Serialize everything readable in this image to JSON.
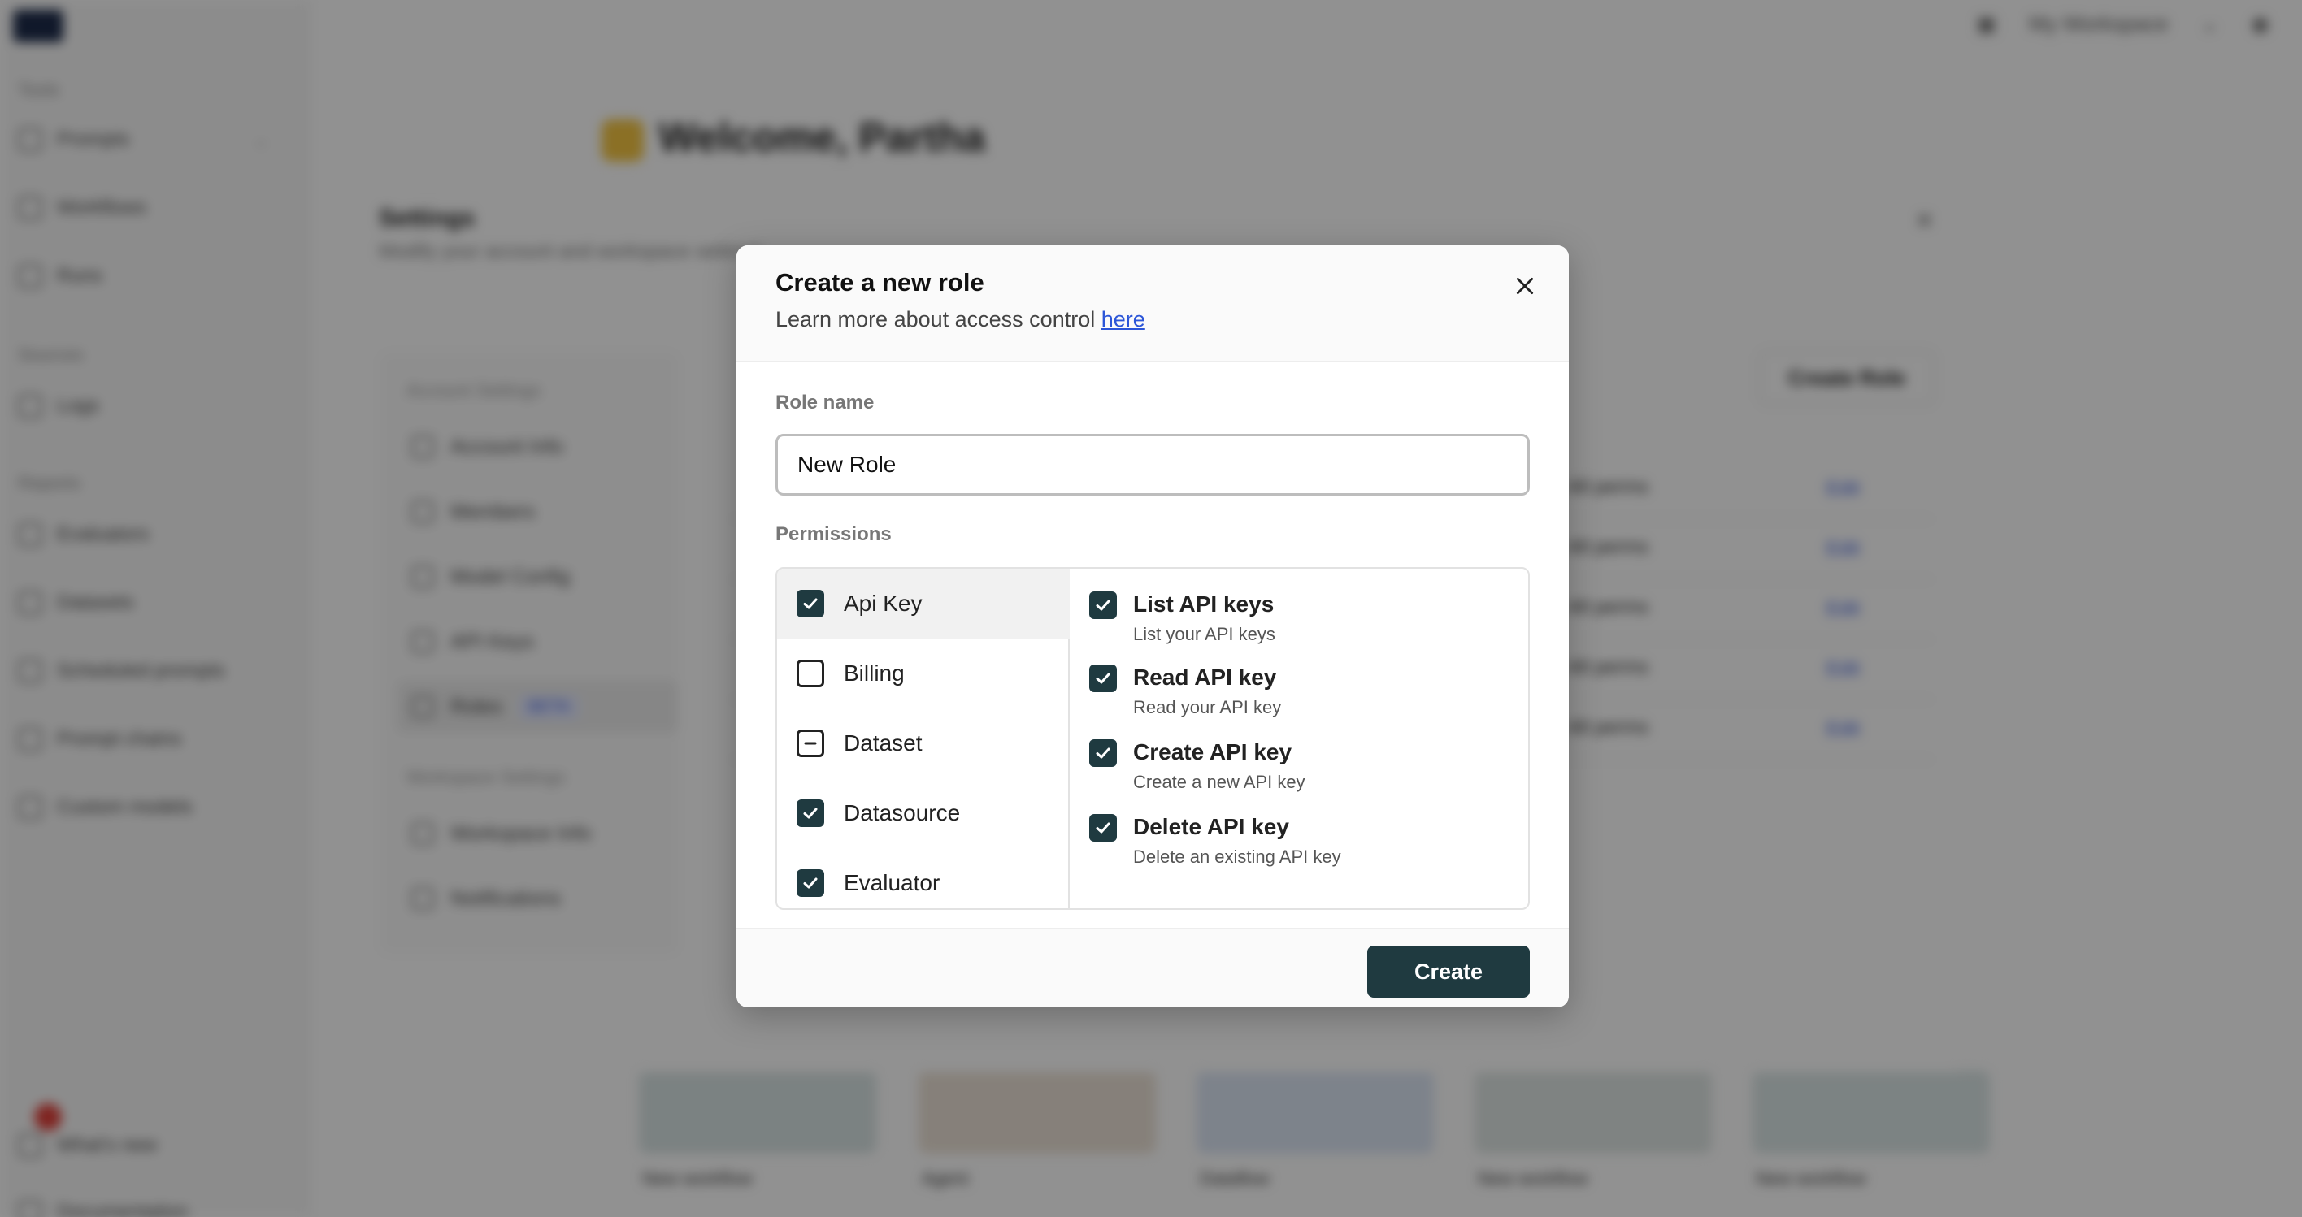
{
  "background": {
    "sidebar": {
      "labels": [
        "Tools",
        "Sources",
        "Reports"
      ],
      "items": [
        "Prompts",
        "Workflows",
        "Runs",
        "Logs",
        "Evaluators",
        "Datasets",
        "Scheduled prompts",
        "Prompt chains",
        "Custom models"
      ],
      "help": "What's new",
      "docs": "Documentation"
    },
    "topbar": {
      "workspace": "My Workspace"
    },
    "welcome": "Welcome, Partha",
    "cards": [
      "New workflow",
      "Agent",
      "Dataflow",
      "New workflow",
      "New workflow"
    ],
    "settings": {
      "title": "Settings",
      "subtitle": "Modify your account and workspace settings",
      "nav_account_label": "Account Settings",
      "nav_items": [
        "Account Info",
        "Members",
        "Model Config",
        "API Keys",
        "Roles"
      ],
      "beta": "BETA",
      "nav_workspace_label": "Workspace Settings",
      "nav_workspace_items": [
        "Workspace Info",
        "Notifications"
      ],
      "create_role": "Create Role",
      "row_perm": "All perms",
      "row_edit": "Edit"
    }
  },
  "modal": {
    "title": "Create a new role",
    "subtitle": "Learn more about access control",
    "subtitle_link": "here",
    "role_name_label": "Role name",
    "role_name_value": "New Role",
    "permissions_label": "Permissions",
    "categories": [
      {
        "label": "Api Key",
        "state": "checked"
      },
      {
        "label": "Billing",
        "state": "unchecked"
      },
      {
        "label": "Dataset",
        "state": "partial"
      },
      {
        "label": "Datasource",
        "state": "checked"
      },
      {
        "label": "Evaluator",
        "state": "checked"
      }
    ],
    "permissions": [
      {
        "name": "List API keys",
        "desc": "List your API keys",
        "state": "checked"
      },
      {
        "name": "Read API key",
        "desc": "Read your API key",
        "state": "checked"
      },
      {
        "name": "Create API key",
        "desc": "Create a new API key",
        "state": "checked"
      },
      {
        "name": "Delete API key",
        "desc": "Delete an existing API key",
        "state": "checked"
      }
    ],
    "create_button": "Create"
  },
  "colors": {
    "primary": "#1f3a40",
    "link": "#2b55d8",
    "overlay": "rgba(0,0,0,0.43)"
  },
  "icons": {
    "close": "close-icon",
    "check": "check-icon",
    "partial": "minus-icon"
  }
}
